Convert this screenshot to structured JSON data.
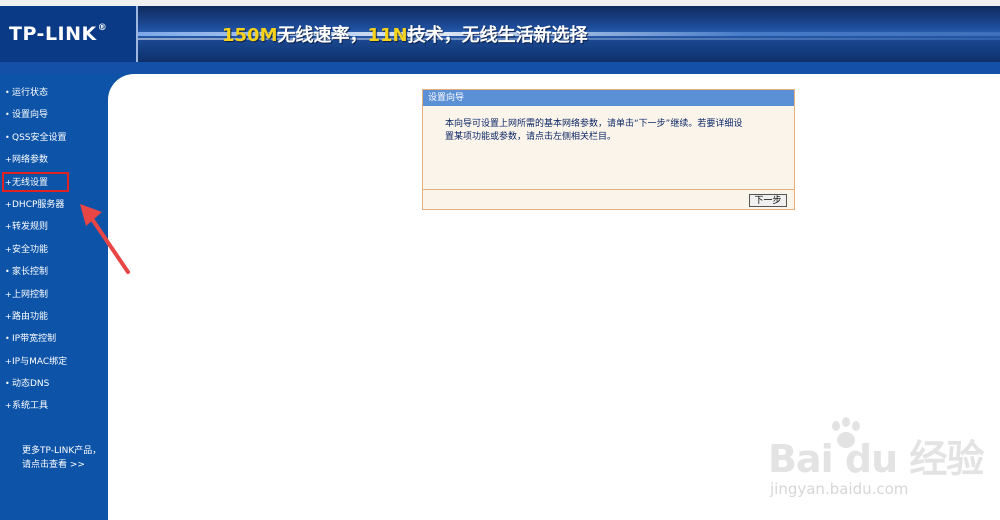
{
  "header": {
    "logo": "TP-LINK",
    "logo_mark": "®",
    "banner": {
      "part1": "150M",
      "part2": "无线速率，",
      "part3": "11N",
      "part4": "技术，无线生活新选择"
    }
  },
  "sidebar": {
    "items": [
      {
        "label": "运行状态"
      },
      {
        "label": "设置向导"
      },
      {
        "label": "QSS安全设置"
      },
      {
        "label": "网络参数"
      },
      {
        "label": "无线设置"
      },
      {
        "label": "DHCP服务器"
      },
      {
        "label": "转发规则"
      },
      {
        "label": "安全功能"
      },
      {
        "label": "家长控制"
      },
      {
        "label": "上网控制"
      },
      {
        "label": "路由功能"
      },
      {
        "label": "IP带宽控制"
      },
      {
        "label": "IP与MAC绑定"
      },
      {
        "label": "动态DNS"
      },
      {
        "label": "系统工具"
      }
    ],
    "selected": "无线设置",
    "more_line1": "更多TP-LINK产品，",
    "more_line2": "请点击查看 >>"
  },
  "panel": {
    "title": "设置向导",
    "body_line1": "本向导可设置上网所需的基本网络参数，请单击“下一步”继续。若要详细设",
    "body_line2": "置某项功能或参数，请点击左侧相关栏目。",
    "next_button": "下一步"
  },
  "watermark": {
    "brand": "Bai du 经验",
    "url": "jingyan.baidu.com"
  },
  "colors": {
    "sidebar": "#0d54a8",
    "header": "#0d3f8f",
    "highlight_yellow": "#f6d21b",
    "panel_border": "#e6b07a",
    "panel_head": "#5b8fd6",
    "annotation_red": "#e02222"
  }
}
